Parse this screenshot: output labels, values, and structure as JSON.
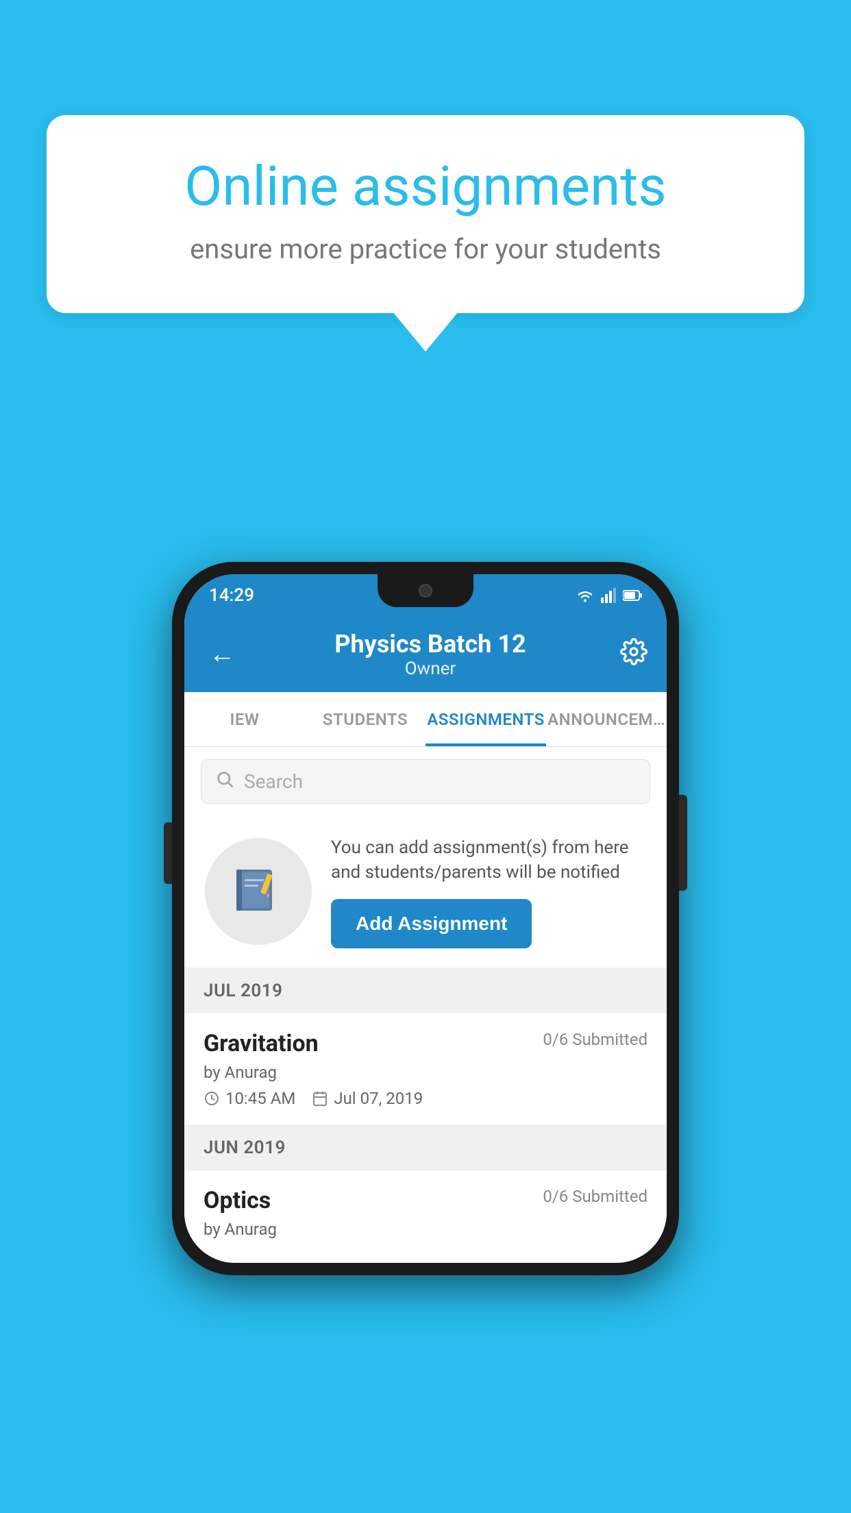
{
  "background_color": "#29BCEC",
  "speech_bubble": {
    "title": "Online assignments",
    "subtitle": "ensure more practice for your students"
  },
  "phone": {
    "status_bar": {
      "time": "14:29",
      "icons": [
        "wifi",
        "signal",
        "battery"
      ]
    },
    "app_bar": {
      "title": "Physics Batch 12",
      "subtitle": "Owner",
      "back_label": "←",
      "settings_label": "⚙"
    },
    "tabs": [
      {
        "label": "IEW",
        "active": false
      },
      {
        "label": "STUDENTS",
        "active": false
      },
      {
        "label": "ASSIGNMENTS",
        "active": true
      },
      {
        "label": "ANNOUNCEM…",
        "active": false
      }
    ],
    "search": {
      "placeholder": "Search"
    },
    "info_card": {
      "text": "You can add assignment(s) from here and students/parents will be notified",
      "button_label": "Add Assignment"
    },
    "sections": [
      {
        "header": "JUL 2019",
        "assignments": [
          {
            "name": "Gravitation",
            "submitted": "0/6 Submitted",
            "author": "by Anurag",
            "time": "10:45 AM",
            "date": "Jul 07, 2019"
          }
        ]
      },
      {
        "header": "JUN 2019",
        "assignments": [
          {
            "name": "Optics",
            "submitted": "0/6 Submitted",
            "author": "by Anurag",
            "time": "",
            "date": ""
          }
        ]
      }
    ]
  }
}
